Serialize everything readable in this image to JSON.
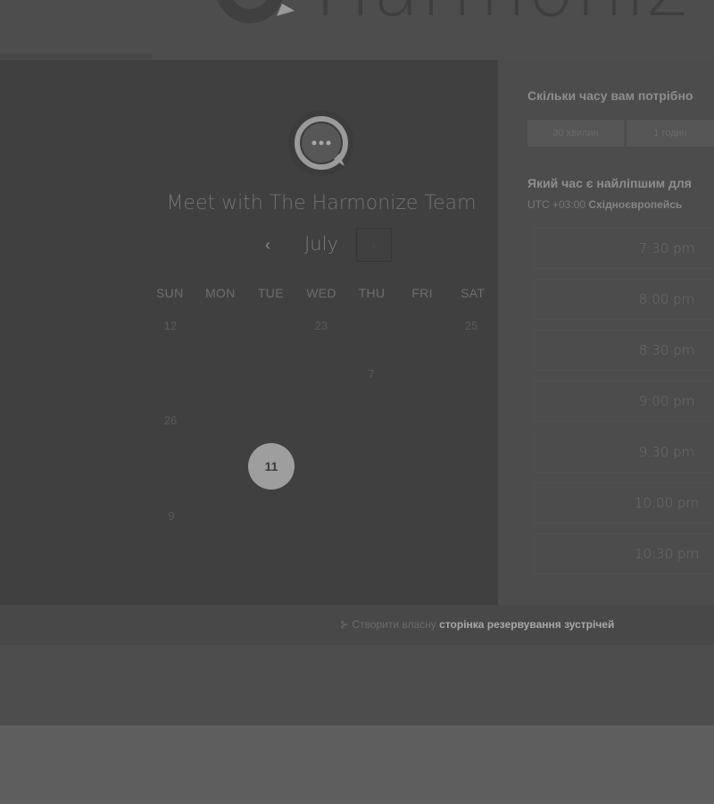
{
  "logo": {
    "text": "Harmoniz"
  },
  "meeting": {
    "title": "Meet with The Harmonize Team"
  },
  "calendar": {
    "month": "July",
    "prev_icon": "chevron-left-icon",
    "next_icon": "chevron-right-icon",
    "weekdays": [
      "SUN",
      "MON",
      "TUE",
      "WED",
      "THU",
      "FRI",
      "SAT"
    ],
    "days": {
      "d12": "12",
      "d23": "23",
      "d25": "25",
      "d7": "7",
      "d26": "26",
      "d11": "11",
      "d9": "9"
    }
  },
  "duration": {
    "question": "Скільки часу вам потрібно",
    "options": [
      "30 хвилин",
      "1 годин"
    ]
  },
  "time": {
    "question": "Який час є найліпшим для",
    "tz_offset": "UTC +03:00",
    "tz_name": "Східноєвропейсь",
    "slots": [
      "7:30 pm",
      "8:00 pm",
      "8:30 pm",
      "9:00 pm",
      "9:30 pm",
      "10:00 pm",
      "10:30 pm"
    ]
  },
  "footer": {
    "prefix": "Створити власну",
    "link": "сторінка резервування зустрічей"
  }
}
